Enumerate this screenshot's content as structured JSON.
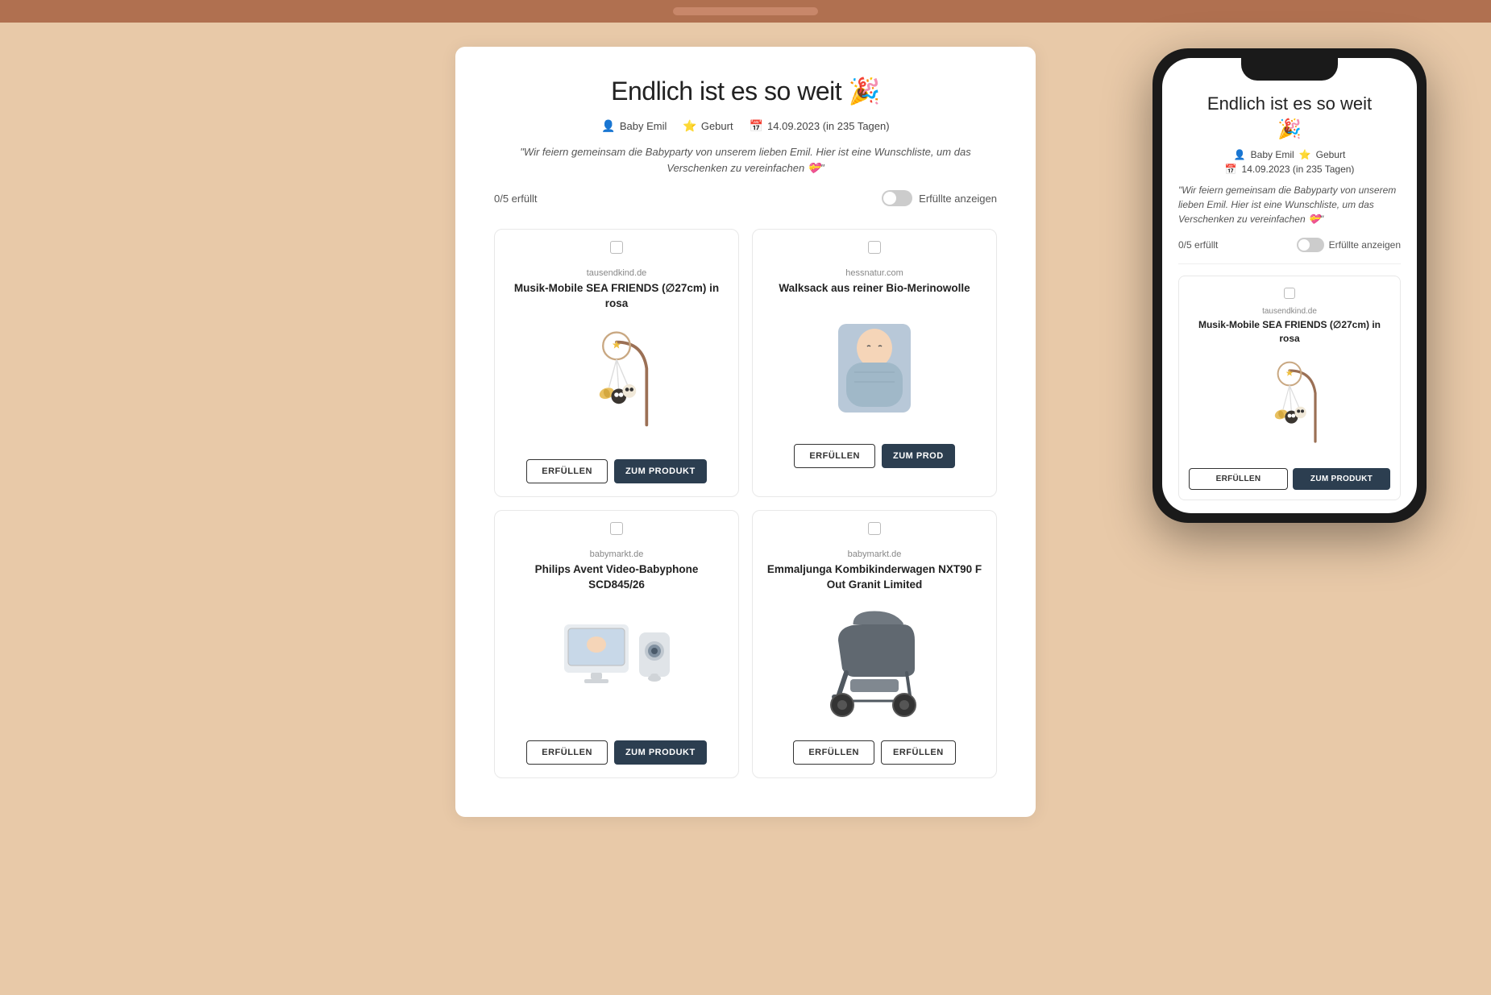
{
  "topBar": {},
  "header": {
    "title": "Endlich ist es so weit 🎉",
    "emoji": "🎉",
    "meta": {
      "name": "Baby Emil",
      "event": "Geburt",
      "date": "14.09.2023 (in 235 Tagen)"
    },
    "description": "\"Wir feiern gemeinsam die Babyparty von unserem lieben Emil. Hier ist eine Wunschliste, um das Verschenken zu vereinfachen 💝\"",
    "progress": "0/5 erfüllt",
    "toggleLabel": "Erfüllte anzeigen"
  },
  "products": [
    {
      "id": "music-mobile",
      "source": "tausendkind.de",
      "name": "Musik-Mobile SEA FRIENDS (∅27cm) in rosa",
      "erfuellenLabel": "ERFÜLLEN",
      "productLabel": "ZUM PRODUKT"
    },
    {
      "id": "walksack",
      "source": "hessnatur.com",
      "name": "Walksack aus reiner Bio-Merinowolle",
      "erfuellenLabel": "ERFÜLLEN",
      "productLabel": "ZUM PROD"
    },
    {
      "id": "babyphone",
      "source": "babymarkt.de",
      "name": "Philips Avent Video-Babyphone SCD845/26",
      "erfuellenLabel": "ERFÜLLEN",
      "productLabel": "ZUM PRODUKT"
    },
    {
      "id": "stroller",
      "source": "babymarkt.de",
      "name": "Emmaljunga Kombikinderwagen NXT90 F Out Granit Limited",
      "erfuellenLabel": "ERFÜLLEN",
      "productLabel": "ERFÜLLEN"
    }
  ],
  "phone": {
    "title": "Endlich ist es so weit",
    "emoji": "🎉",
    "metaName": "Baby Emil",
    "metaEvent": "Geburt",
    "metaDate": "14.09.2023 (in 235 Tagen)",
    "description": "\"Wir feiern gemeinsam die Babyparty von unserem lieben Emil. Hier ist eine Wunschliste, um das Verschenken zu vereinfachen 💝\"",
    "progress": "0/5 erfüllt",
    "toggleLabel": "Erfüllte anzeigen",
    "productSource": "tausendkind.de",
    "productName": "Musik-Mobile SEA FRIENDS (∅27cm) in rosa",
    "erfuellenLabel": "ERFÜLLEN",
    "productLabel": "ZUM PRODUKT"
  },
  "icons": {
    "person": "👤",
    "star": "⭐",
    "calendar": "📅"
  }
}
